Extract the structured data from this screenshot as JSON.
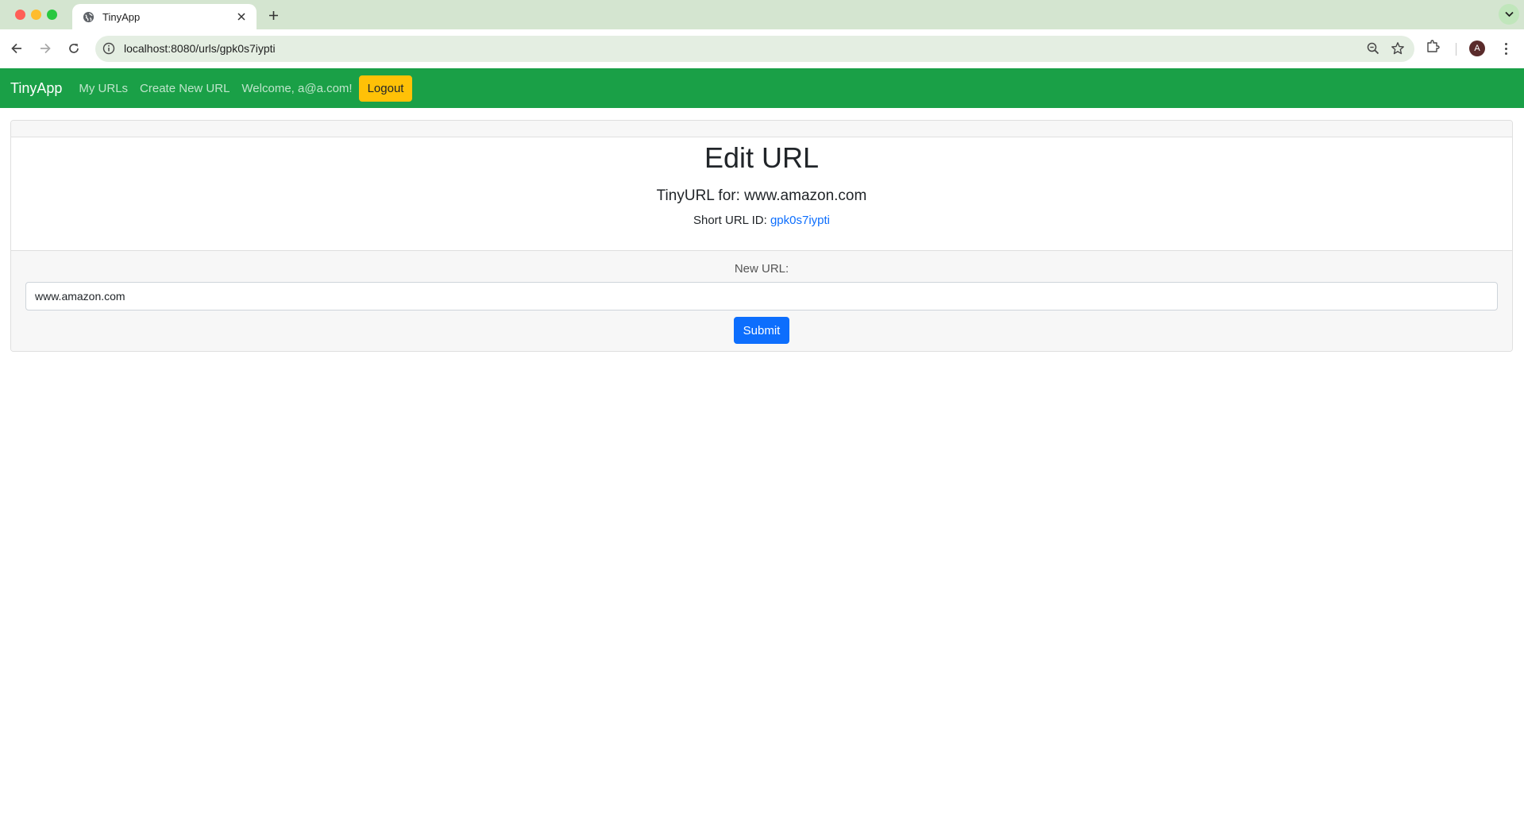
{
  "browser": {
    "tab_title": "TinyApp",
    "address": "localhost:8080/urls/gpk0s7iypti",
    "profile_initial": "A",
    "icons": [
      "globe-icon",
      "close-icon",
      "plus-icon",
      "chevron-down-icon",
      "back-arrow-icon",
      "forward-arrow-icon",
      "reload-icon",
      "site-info-icon",
      "zoom-icon",
      "star-icon",
      "extensions-icon",
      "kebab-menu-icon"
    ]
  },
  "navbar": {
    "brand": "TinyApp",
    "my_urls": "My URLs",
    "create_new": "Create New URL",
    "welcome": "Welcome, a@a.com!",
    "logout": "Logout",
    "color": "#1aa047"
  },
  "card": {
    "title": "Edit URL",
    "subtitle": "TinyURL for: www.amazon.com",
    "short_id_label": "Short URL ID: ",
    "short_id": "gpk0s7iypti"
  },
  "form": {
    "label": "New URL:",
    "value": "www.amazon.com",
    "submit": "Submit"
  }
}
